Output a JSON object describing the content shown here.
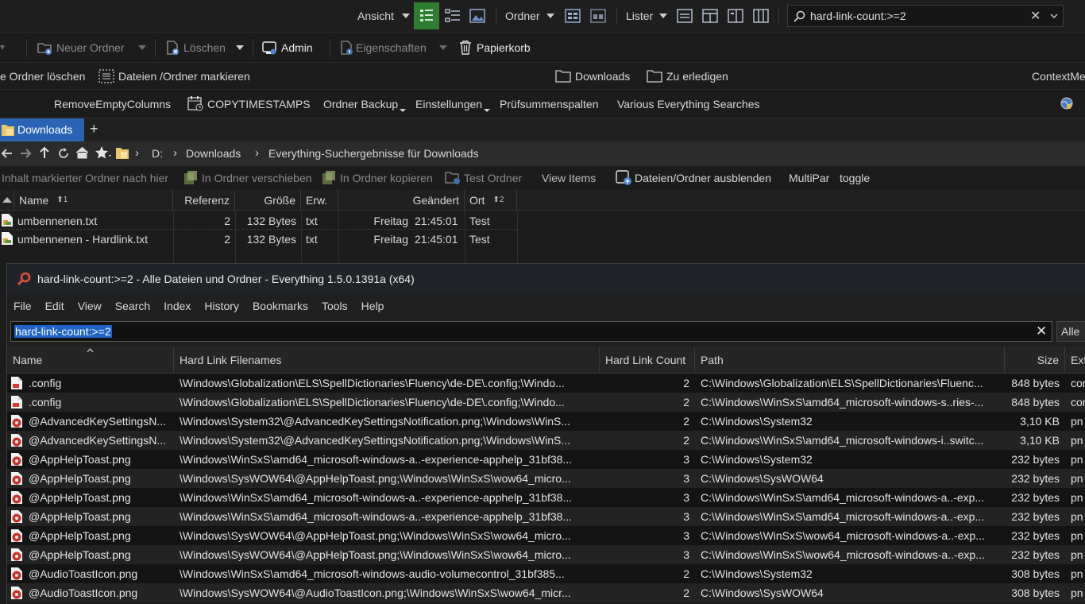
{
  "toolbar_top": {
    "view_label": "Ansicht",
    "folder_label": "Ordner",
    "list_label": "Lister",
    "search_value": "hard-link-count:>=2"
  },
  "toolbar_2": {
    "new_folder": "Neuer Ordner",
    "delete": "Löschen",
    "admin": "Admin",
    "properties": "Eigenschaften",
    "recycle_bin": "Papierkorb"
  },
  "toolbar_3": {
    "delete_folder": "e Ordner löschen",
    "mark_files": "Dateien /Ordner markieren",
    "downloads": "Downloads",
    "todo": "Zu erledigen",
    "context_menu": "ContextMe"
  },
  "toolbar_4": {
    "remove_empty_columns": "RemoveEmptyColumns",
    "copy_timestamps": "COPYTIMESTAMPS",
    "folder_backup": "Ordner Backup",
    "settings": "Einstellungen",
    "checksum_columns": "Prüfsummenspalten",
    "everything_searches": "Various Everything Searches"
  },
  "tabs": [
    {
      "label": "Downloads"
    }
  ],
  "tab_add": "+",
  "breadcrumb": {
    "drive": "D:",
    "folder": "Downloads",
    "current": "Everything-Suchergebnisse für Downloads"
  },
  "actionbar": {
    "move_contents": "Inhalt markierter Ordner nach hier",
    "move_to_folder": "In Ordner verschieben",
    "copy_to_folder": "In Ordner kopieren",
    "test_folder": "Test Ordner",
    "view_items": "View Items",
    "hide_items": "Dateien/Ordner ausblenden",
    "multipar": "MultiPar",
    "toggle": "toggle"
  },
  "filelist": {
    "columns": {
      "name": "Name",
      "name_sort": "1",
      "reference": "Referenz",
      "size": "Größe",
      "ext": "Erw.",
      "modified": "Geändert",
      "location": "Ort",
      "location_sort": "2"
    },
    "rows": [
      {
        "name": "umbennenen.txt",
        "reference": "2",
        "size": "132 Bytes",
        "ext": "txt",
        "day": "Freitag",
        "time": "21:45:01",
        "location": "Test"
      },
      {
        "name": "umbennenen - Hardlink.txt",
        "reference": "2",
        "size": "132 Bytes",
        "ext": "txt",
        "day": "Freitag",
        "time": "21:45:01",
        "location": "Test"
      }
    ]
  },
  "everything": {
    "title": "hard-link-count:>=2 - Alle Dateien und Ordner - Everything 1.5.0.1391a (x64)",
    "menu": [
      "File",
      "Edit",
      "View",
      "Search",
      "Index",
      "History",
      "Bookmarks",
      "Tools",
      "Help"
    ],
    "search_value": "hard-link-count:>=2",
    "filter": "Alle",
    "columns": {
      "name": "Name",
      "hardlink_filenames": "Hard Link Filenames",
      "hardlink_count": "Hard Link Count",
      "path": "Path",
      "size": "Size",
      "ext": "Ext"
    },
    "rows": [
      {
        "icon": "config",
        "name": ".config",
        "hl": "\\Windows\\Globalization\\ELS\\SpellDictionaries\\Fluency\\de-DE\\.config;\\Windo...",
        "count": "2",
        "path": "C:\\Windows\\Globalization\\ELS\\SpellDictionaries\\Fluenc...",
        "size": "848 bytes",
        "ext": "cor"
      },
      {
        "icon": "config",
        "name": ".config",
        "hl": "\\Windows\\Globalization\\ELS\\SpellDictionaries\\Fluency\\de-DE\\.config;\\Windo...",
        "count": "2",
        "path": "C:\\Windows\\WinSxS\\amd64_microsoft-windows-s..ries-...",
        "size": "848 bytes",
        "ext": "cor"
      },
      {
        "icon": "png",
        "name": "@AdvancedKeySettingsN...",
        "hl": "\\Windows\\System32\\@AdvancedKeySettingsNotification.png;\\Windows\\WinS...",
        "count": "2",
        "path": "C:\\Windows\\System32",
        "size": "3,10 KB",
        "ext": "pn"
      },
      {
        "icon": "png",
        "name": "@AdvancedKeySettingsN...",
        "hl": "\\Windows\\System32\\@AdvancedKeySettingsNotification.png;\\Windows\\WinS...",
        "count": "2",
        "path": "C:\\Windows\\WinSxS\\amd64_microsoft-windows-i..switc...",
        "size": "3,10 KB",
        "ext": "pn"
      },
      {
        "icon": "png",
        "name": "@AppHelpToast.png",
        "hl": "\\Windows\\WinSxS\\amd64_microsoft-windows-a..-experience-apphelp_31bf38...",
        "count": "3",
        "path": "C:\\Windows\\System32",
        "size": "232 bytes",
        "ext": "pn"
      },
      {
        "icon": "png",
        "name": "@AppHelpToast.png",
        "hl": "\\Windows\\SysWOW64\\@AppHelpToast.png;\\Windows\\WinSxS\\wow64_micro...",
        "count": "3",
        "path": "C:\\Windows\\SysWOW64",
        "size": "232 bytes",
        "ext": "pn"
      },
      {
        "icon": "png",
        "name": "@AppHelpToast.png",
        "hl": "\\Windows\\WinSxS\\amd64_microsoft-windows-a..-experience-apphelp_31bf38...",
        "count": "3",
        "path": "C:\\Windows\\WinSxS\\amd64_microsoft-windows-a..-exp...",
        "size": "232 bytes",
        "ext": "pn"
      },
      {
        "icon": "png",
        "name": "@AppHelpToast.png",
        "hl": "\\Windows\\WinSxS\\amd64_microsoft-windows-a..-experience-apphelp_31bf38...",
        "count": "3",
        "path": "C:\\Windows\\WinSxS\\amd64_microsoft-windows-a..-exp...",
        "size": "232 bytes",
        "ext": "pn"
      },
      {
        "icon": "png",
        "name": "@AppHelpToast.png",
        "hl": "\\Windows\\SysWOW64\\@AppHelpToast.png;\\Windows\\WinSxS\\wow64_micro...",
        "count": "3",
        "path": "C:\\Windows\\WinSxS\\wow64_microsoft-windows-a..-exp...",
        "size": "232 bytes",
        "ext": "pn"
      },
      {
        "icon": "png",
        "name": "@AppHelpToast.png",
        "hl": "\\Windows\\SysWOW64\\@AppHelpToast.png;\\Windows\\WinSxS\\wow64_micro...",
        "count": "3",
        "path": "C:\\Windows\\WinSxS\\wow64_microsoft-windows-a..-exp...",
        "size": "232 bytes",
        "ext": "pn"
      },
      {
        "icon": "png",
        "name": "@AudioToastIcon.png",
        "hl": "\\Windows\\WinSxS\\amd64_microsoft-windows-audio-volumecontrol_31bf385...",
        "count": "2",
        "path": "C:\\Windows\\System32",
        "size": "308 bytes",
        "ext": "pn"
      },
      {
        "icon": "png",
        "name": "@AudioToastIcon.png",
        "hl": "\\Windows\\SysWOW64\\@AudioToastIcon.png;\\Windows\\WinSxS\\wow64_micr...",
        "count": "2",
        "path": "C:\\Windows\\SysWOW64",
        "size": "308 bytes",
        "ext": "pn"
      }
    ]
  },
  "colors": {
    "accent_blue": "#2b63b3",
    "active_view_green": "#2f7d32",
    "search_icon_red": "#e0503c"
  }
}
